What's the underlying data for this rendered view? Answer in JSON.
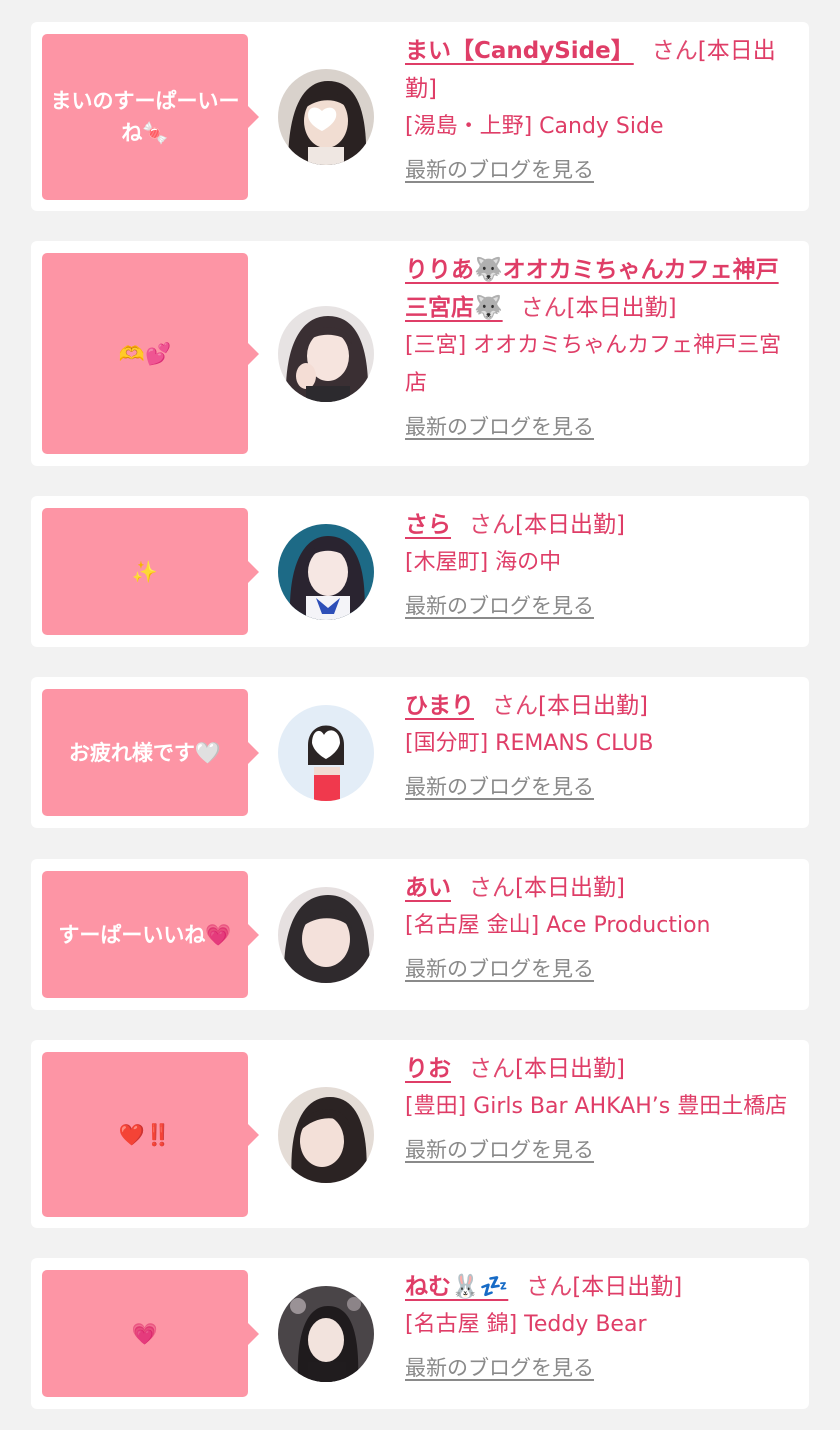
{
  "blog_link_label": "最新のブログを見る",
  "honorific": "さん",
  "accent_color": "#df3d67",
  "bubble_color": "#fd95a5",
  "entries": [
    {
      "bubble": "まいのすーぱーいーね🍬",
      "name": "まい【CandySide】",
      "status": "[本日出勤]",
      "shop": "[湯島・上野] Candy Side"
    },
    {
      "bubble": "🫶💕",
      "name": "りりあ🐺オオカミちゃんカフェ神戸三宮店🐺",
      "status": "[本日出勤]",
      "shop": "[三宮] オオカミちゃんカフェ神戸三宮店"
    },
    {
      "bubble": "✨",
      "name": "さら",
      "status": "[本日出勤]",
      "shop": "[木屋町] 海の中"
    },
    {
      "bubble": "お疲れ様です🤍",
      "name": "ひまり",
      "status": "[本日出勤]",
      "shop": "[国分町] REMANS CLUB"
    },
    {
      "bubble": "すーぱーいいね💗",
      "name": "あい",
      "status": "[本日出勤]",
      "shop": "[名古屋 金山] Ace Production"
    },
    {
      "bubble": "❤️‼️",
      "name": "りお",
      "status": "[本日出勤]",
      "shop": "[豊田] Girls Bar AHKAH’s 豊田土橋店"
    },
    {
      "bubble": "💗",
      "name": "ねむ🐰💤",
      "status": "[本日出勤]",
      "shop": "[名古屋 錦] Teddy Bear"
    }
  ]
}
